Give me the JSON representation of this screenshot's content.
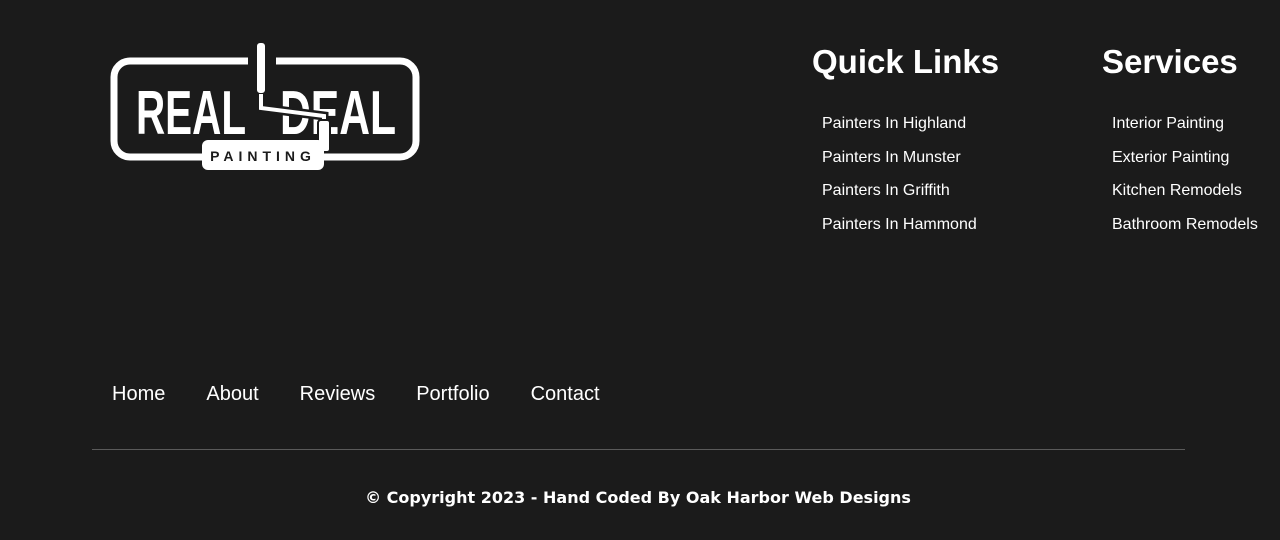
{
  "logo": {
    "word_left": "REAL",
    "word_right": "DEAL",
    "tagline": "PAINTING",
    "icon": "paint-roller-icon"
  },
  "quick_links": {
    "heading": "Quick Links",
    "items": [
      "Painters In Highland",
      "Painters In Munster",
      "Painters In Griffith",
      "Painters In Hammond"
    ]
  },
  "services": {
    "heading": "Services",
    "items": [
      "Interior Painting",
      "Exterior Painting",
      "Kitchen Remodels",
      "Bathroom Remodels"
    ]
  },
  "nav": {
    "items": [
      "Home",
      "About",
      "Reviews",
      "Portfolio",
      "Contact"
    ]
  },
  "copyright": "© Copyright 2023 - Hand Coded By Oak Harbor Web Designs",
  "colors": {
    "background": "#1b1b1b",
    "text": "#ffffff",
    "divider": "#5a5a5a"
  }
}
